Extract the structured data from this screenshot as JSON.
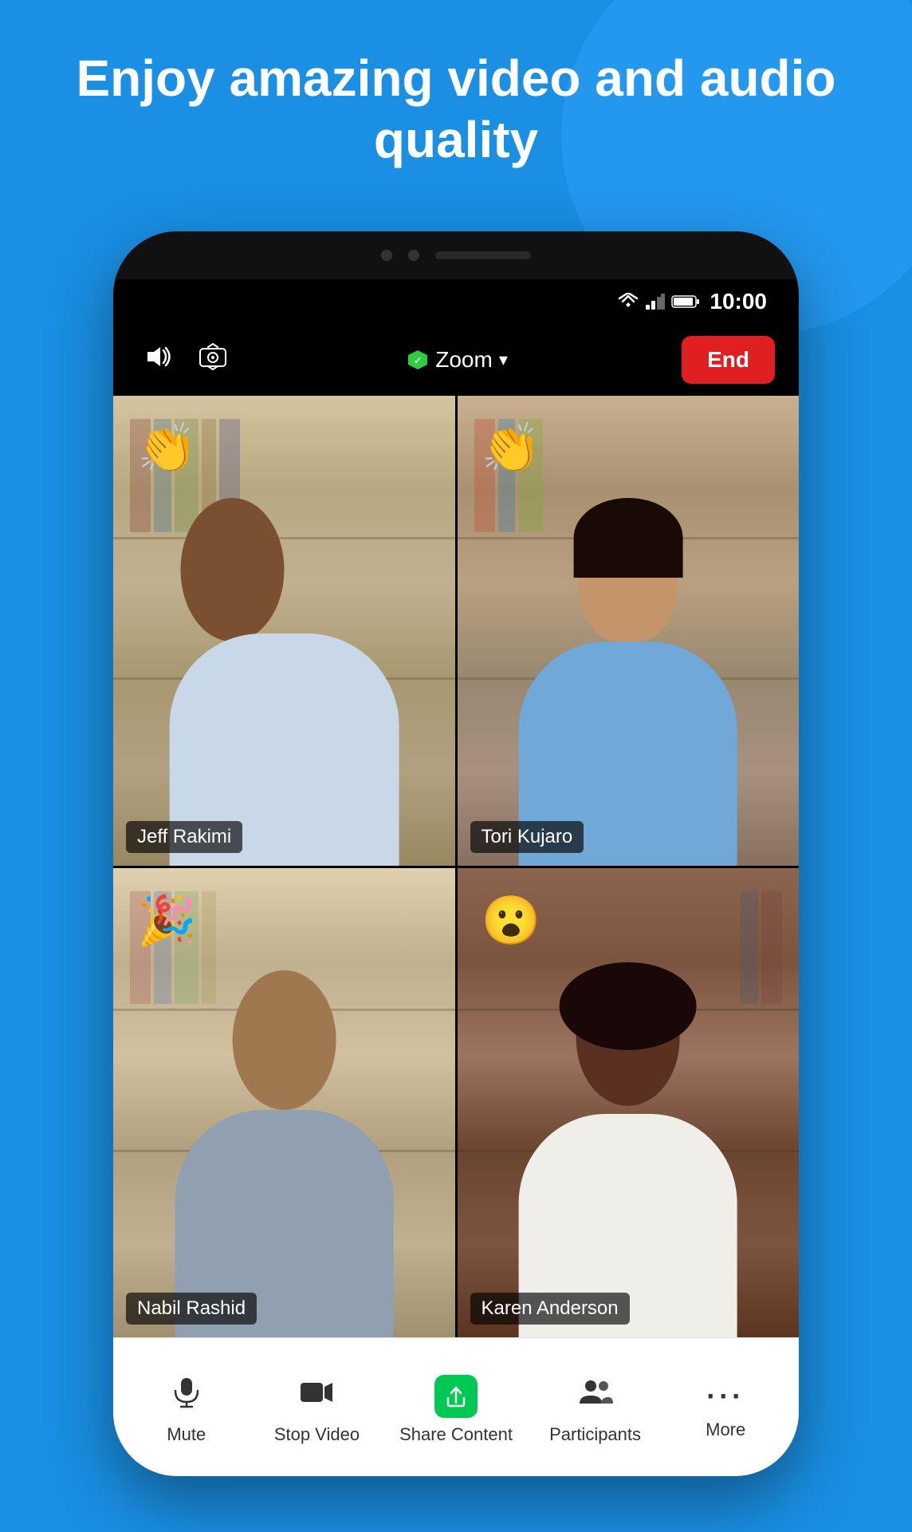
{
  "page": {
    "background_color": "#1a8fe3",
    "hero_title": "Enjoy amazing video and audio quality"
  },
  "status_bar": {
    "time": "10:00",
    "wifi_icon": "▼",
    "signal_icon": "▲",
    "battery_icon": "🔋"
  },
  "meeting_controls": {
    "speaker_icon": "🔊",
    "camera_flip_icon": "🔄",
    "zoom_label": "Zoom",
    "end_button_label": "End"
  },
  "participants": [
    {
      "name": "Jeff Rakimi",
      "emoji": "👏",
      "active_speaker": false,
      "position": "top-left"
    },
    {
      "name": "Tori Kujaro",
      "emoji": "👏",
      "active_speaker": true,
      "position": "top-right"
    },
    {
      "name": "Nabil Rashid",
      "emoji": "🎉",
      "active_speaker": false,
      "position": "bottom-left"
    },
    {
      "name": "Karen Anderson",
      "emoji": "😮",
      "active_speaker": false,
      "position": "bottom-right"
    }
  ],
  "toolbar": {
    "mute_label": "Mute",
    "stop_video_label": "Stop Video",
    "share_content_label": "Share Content",
    "participants_label": "Participants",
    "more_label": "More"
  }
}
